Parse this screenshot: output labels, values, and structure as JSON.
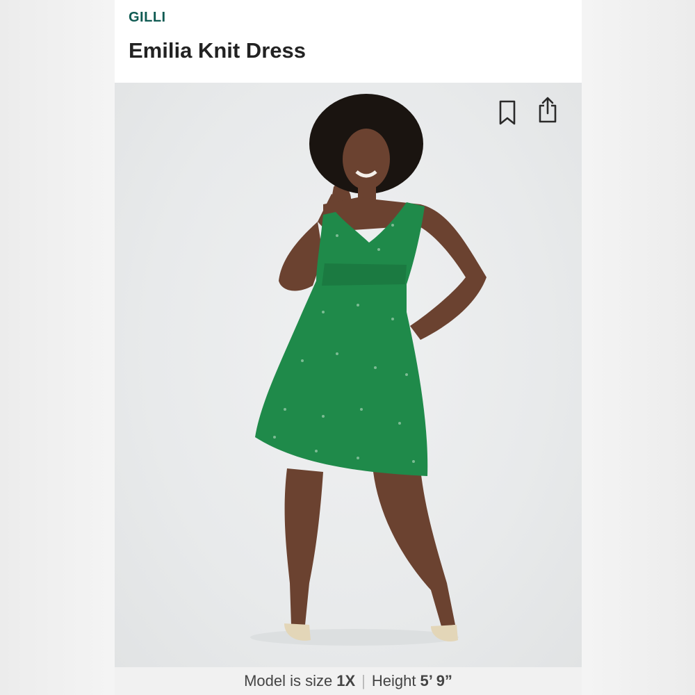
{
  "header": {
    "brand": "GILLI",
    "title": "Emilia Knit Dress"
  },
  "photo": {
    "actions": [
      {
        "name": "bookmark",
        "icon": "bookmark-icon"
      },
      {
        "name": "share",
        "icon": "share-icon"
      }
    ]
  },
  "footer": {
    "size_label": "Model is size",
    "size_value": "1X",
    "separator": "|",
    "height_label": "Height",
    "height_value": "5’ 9”"
  },
  "colors": {
    "brand": "#0f5a52",
    "title": "#222222",
    "dress": "#1f8a4a",
    "icon": "#2a2a2a"
  }
}
